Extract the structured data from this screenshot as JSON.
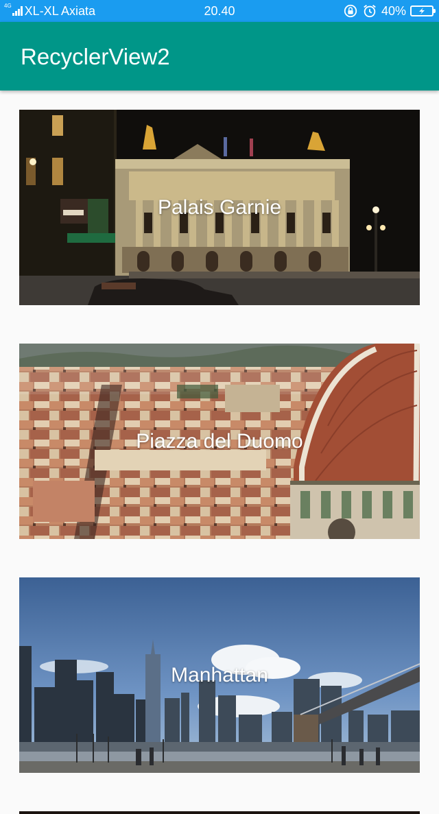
{
  "status_bar": {
    "network_type": "4G",
    "carrier": "XL-XL Axiata",
    "time": "20.40",
    "battery_percent": "40%",
    "battery_level": 0.4,
    "icons": [
      "signal-icon",
      "rotation-lock-icon",
      "alarm-icon",
      "battery-charging-icon"
    ]
  },
  "app_bar": {
    "title": "RecyclerView2",
    "color": "#009688"
  },
  "list": {
    "items": [
      {
        "title": "Palais Garnie",
        "image": "palais-garnier-night-photo"
      },
      {
        "title": "Piazza del Duomo",
        "image": "florence-duomo-aerial-photo"
      },
      {
        "title": "Manhattan",
        "image": "manhattan-skyline-photo"
      }
    ]
  }
}
